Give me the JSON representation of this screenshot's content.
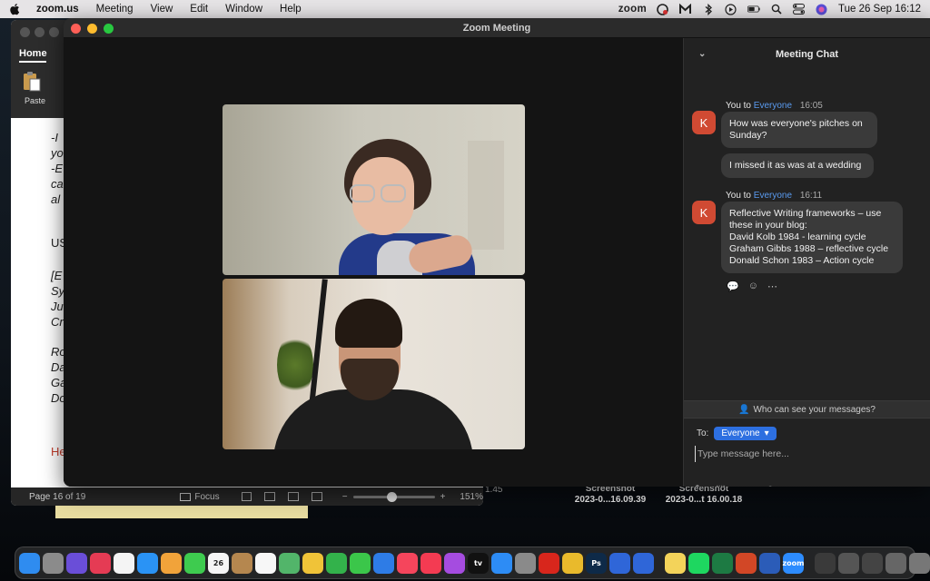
{
  "menubar": {
    "app_name": "zoom.us",
    "items": [
      "Meeting",
      "View",
      "Edit",
      "Window",
      "Help"
    ],
    "status_zoom": "zoom",
    "clock": "Tue 26 Sep  16:12"
  },
  "word": {
    "tab_home": "Home",
    "paste_label": "Paste",
    "doc_lines": [
      "-I",
      "yo",
      "-E",
      "ca",
      "al",
      "US",
      "[E",
      "Sy",
      "Ju",
      "Cr",
      "Ro",
      "Da",
      "Ga",
      "Do"
    ],
    "doc_red": "He",
    "status": {
      "page": "Page 16 of 19",
      "focus": "Focus",
      "zoom": "151%",
      "zoom_fraction": 0.42
    },
    "peek_number": "1.45"
  },
  "desktop": {
    "files": [
      {
        "line1": "Screenshot",
        "line2": "2023-0...16.09.39"
      },
      {
        "line1": "Screenshot",
        "line2": "2023-0...t 16.00.18"
      }
    ]
  },
  "zoom": {
    "window_title": "Zoom Meeting",
    "chat": {
      "title": "Meeting Chat",
      "groups": [
        {
          "avatar": "K",
          "sender": "You to",
          "recipient": "Everyone",
          "time": "16:05",
          "messages": [
            "How was everyone's pitches on\nSunday?",
            "I missed it as was at a wedding"
          ]
        },
        {
          "avatar": "K",
          "sender": "You to",
          "recipient": "Everyone",
          "time": "16:11",
          "messages": [
            "Reflective Writing frameworks – use\nthese in your blog:\nDavid Kolb 1984  - learning cycle\nGraham Gibbs 1988 – reflective cycle\nDonald Schon 1983 – Action cycle"
          ]
        }
      ],
      "who_can_see": "Who can see your messages?",
      "to_label": "To:",
      "to_value": "Everyone",
      "input_placeholder": "Type message here..."
    }
  },
  "dock": {
    "icons": [
      {
        "name": "finder",
        "color": "#2f8cf0"
      },
      {
        "name": "launchpad",
        "color": "#8b8b8b"
      },
      {
        "name": "siri",
        "color": "#6a4ed8"
      },
      {
        "name": "creative-cloud",
        "color": "#e53b54"
      },
      {
        "name": "notes-app",
        "color": "#f4f4f4"
      },
      {
        "name": "safari",
        "color": "#2a93f5"
      },
      {
        "name": "pages",
        "color": "#f1a33a"
      },
      {
        "name": "messages",
        "color": "#3ecb4f"
      },
      {
        "name": "calendar",
        "color": "#f5f5f5",
        "label": "26"
      },
      {
        "name": "contacts",
        "color": "#b5874f"
      },
      {
        "name": "reminders",
        "color": "#f7f7f7"
      },
      {
        "name": "maps",
        "color": "#52b56a"
      },
      {
        "name": "photos",
        "color": "#f0c338"
      },
      {
        "name": "numbers",
        "color": "#33b24b"
      },
      {
        "name": "facetime",
        "color": "#3bc64a"
      },
      {
        "name": "keynote",
        "color": "#2e7ce6"
      },
      {
        "name": "news",
        "color": "#f5455c"
      },
      {
        "name": "music",
        "color": "#f43b52"
      },
      {
        "name": "podcasts",
        "color": "#a54ce0"
      },
      {
        "name": "apple-tv",
        "color": "#111111",
        "label": "tv"
      },
      {
        "name": "app-store",
        "color": "#2d8cf5"
      },
      {
        "name": "system-settings",
        "color": "#8a8a8a"
      },
      {
        "name": "acrobat",
        "color": "#d8261c"
      },
      {
        "name": "chrome",
        "color": "#e9ba2c"
      },
      {
        "name": "photoshop",
        "color": "#0e2a48",
        "label": "Ps"
      },
      {
        "name": "screen-share",
        "color": "#2f66d8"
      },
      {
        "name": "screen-share-2",
        "color": "#2f66d8"
      },
      {
        "name": "stickies",
        "color": "#f3d35a"
      },
      {
        "name": "spotify",
        "color": "#1ed760"
      },
      {
        "name": "excel",
        "color": "#1d7a43"
      },
      {
        "name": "powerpoint",
        "color": "#d24726"
      },
      {
        "name": "word-app",
        "color": "#2b5cb8"
      },
      {
        "name": "zoom-app",
        "color": "#2d8cff",
        "label": "zoom"
      },
      {
        "name": "recent-doc-1",
        "color": "#3a3a3a"
      },
      {
        "name": "recent-doc-2",
        "color": "#555555"
      },
      {
        "name": "recent-doc-3",
        "color": "#444444"
      },
      {
        "name": "recent-doc-4",
        "color": "#666666"
      },
      {
        "name": "recent-doc-5",
        "color": "#777777"
      },
      {
        "name": "trash",
        "color": "#9a9a9a"
      }
    ]
  }
}
